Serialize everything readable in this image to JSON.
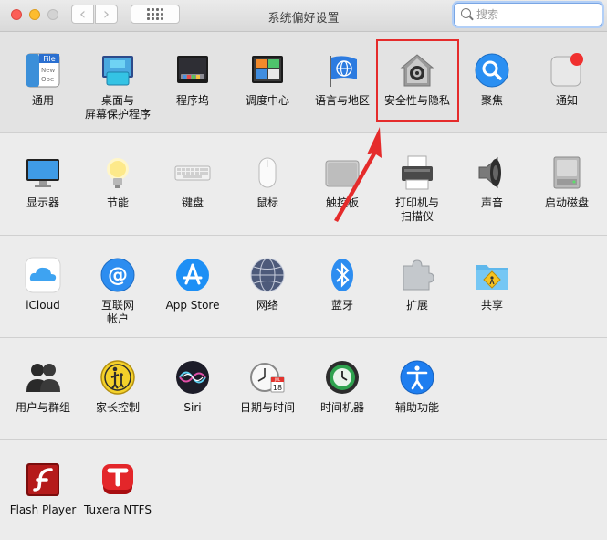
{
  "window": {
    "title": "系统偏好设置"
  },
  "toolbar": {
    "back_label": "‹",
    "forward_label": "›",
    "search_placeholder": "搜索"
  },
  "rows": [
    [
      "通用",
      "桌面与\n屏幕保护程序",
      "程序坞",
      "调度中心",
      "语言与地区",
      "安全性与隐私",
      "聚焦",
      "通知"
    ],
    [
      "显示器",
      "节能",
      "键盘",
      "鼠标",
      "触控板",
      "打印机与\n扫描仪",
      "声音",
      "启动磁盘"
    ],
    [
      "iCloud",
      "互联网\n帐户",
      "App Store",
      "网络",
      "蓝牙",
      "扩展",
      "共享"
    ],
    [
      "用户与群组",
      "家长控制",
      "Siri",
      "日期与时间",
      "时间机器",
      "辅助功能"
    ],
    [
      "Flash Player",
      "Tuxera NTFS"
    ]
  ],
  "icons": {
    "general_file_text": "File",
    "general_lines": [
      "New",
      "Ope"
    ],
    "date_month": "JUL",
    "date_day": "18"
  },
  "annotation": {
    "highlight_color": "#e52b2b"
  }
}
